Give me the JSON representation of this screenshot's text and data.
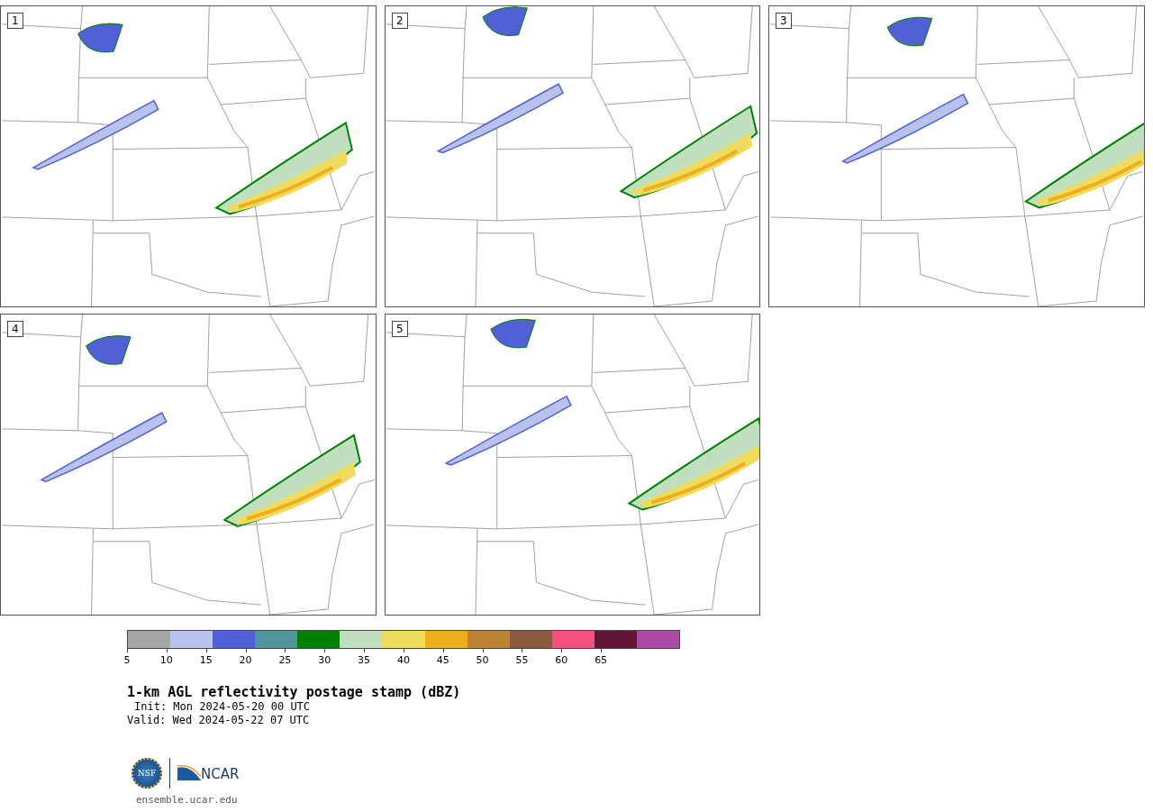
{
  "panels": [
    {
      "number": "1"
    },
    {
      "number": "2"
    },
    {
      "number": "3"
    },
    {
      "number": "4"
    },
    {
      "number": "5"
    }
  ],
  "colorbar": {
    "segments": [
      {
        "color": "#a6a6a6"
      },
      {
        "color": "#b8c2ec"
      },
      {
        "color": "#5160d6"
      },
      {
        "color": "#50959b"
      },
      {
        "color": "#008000"
      },
      {
        "color": "#bfdfbf"
      },
      {
        "color": "#efdc5f"
      },
      {
        "color": "#efae1c"
      },
      {
        "color": "#bb8332"
      },
      {
        "color": "#8a5b3f"
      },
      {
        "color": "#f45081"
      },
      {
        "color": "#611635"
      },
      {
        "color": "#ad4aa6"
      }
    ],
    "ticks": [
      "5",
      "10",
      "15",
      "20",
      "25",
      "30",
      "35",
      "40",
      "45",
      "50",
      "55",
      "60",
      "65"
    ]
  },
  "title": "1-km AGL reflectivity postage stamp (dBZ)",
  "init": "Init: Mon 2024-05-20 00 UTC",
  "valid": "Valid: Wed 2024-05-22 07 UTC",
  "logos": {
    "nsf": "NSF",
    "ncar": "NCAR"
  },
  "url": "ensemble.ucar.edu"
}
